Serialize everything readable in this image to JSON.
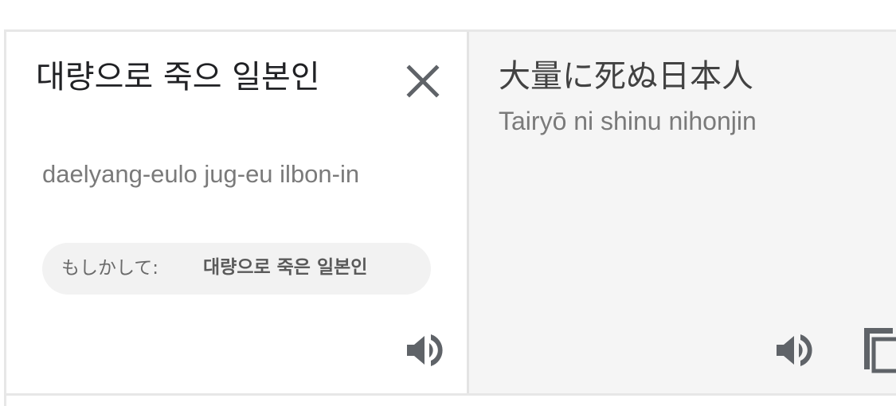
{
  "source": {
    "text": "대량으로 죽으 일본인",
    "transliteration": "daelyang-eulo jug-eu ilbon-in",
    "clear_icon": "close-icon",
    "speaker_icon": "volume-icon"
  },
  "suggestion": {
    "prefix": "もしかして:",
    "value": "대량으로 죽은 일본인"
  },
  "target": {
    "text": "大量に死ぬ日本人",
    "transliteration": "Tairyō ni shinu nihonjin",
    "speaker_icon": "volume-icon",
    "copy_icon": "copy-icon"
  },
  "colors": {
    "icon": "#5f6368",
    "target_background": "#f5f5f5",
    "chip_background": "#f2f2f2",
    "divider": "#e7e7e7"
  }
}
